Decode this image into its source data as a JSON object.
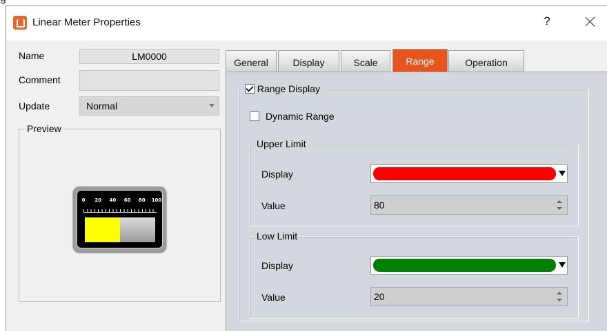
{
  "window": {
    "title": "Linear Meter Properties",
    "help_label": "?"
  },
  "form": {
    "name_label": "Name",
    "name_value": "LM0000",
    "comment_label": "Comment",
    "comment_value": "",
    "update_label": "Update",
    "update_value": "Normal"
  },
  "preview": {
    "legend": "Preview",
    "tick_labels": [
      "0",
      "20",
      "40",
      "60",
      "80",
      "100"
    ]
  },
  "tabs": [
    {
      "label": "General",
      "active": false
    },
    {
      "label": "Display",
      "active": false
    },
    {
      "label": "Scale",
      "active": false
    },
    {
      "label": "Range",
      "active": true
    },
    {
      "label": "Operation",
      "active": false
    }
  ],
  "range": {
    "range_display_label": "Range Display",
    "range_display_checked": true,
    "dynamic_range_label": "Dynamic Range",
    "dynamic_range_checked": false,
    "upper": {
      "legend": "Upper Limit",
      "display_label": "Display",
      "color": "#ff0000",
      "value_label": "Value",
      "value": "80"
    },
    "low": {
      "legend": "Low Limit",
      "display_label": "Display",
      "color": "#008000",
      "value_label": "Value",
      "value": "20"
    }
  },
  "colors": {
    "active_tab": "#e8541c",
    "panel_bg": "#d3d8de"
  }
}
